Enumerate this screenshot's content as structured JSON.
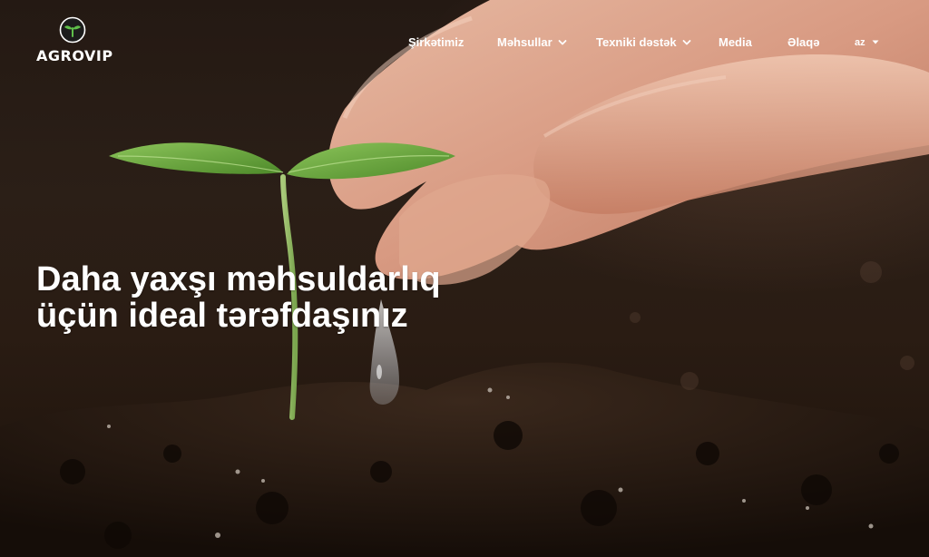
{
  "brand": {
    "logo_text": "AGROVIP"
  },
  "nav": {
    "items": [
      {
        "label": "Şirkətimiz",
        "has_dropdown": false
      },
      {
        "label": "Məhsullar",
        "has_dropdown": true
      },
      {
        "label": "Texniki dəstək",
        "has_dropdown": true
      },
      {
        "label": "Media",
        "has_dropdown": false
      },
      {
        "label": "Əlaqə",
        "has_dropdown": false
      }
    ],
    "language": {
      "label": "az"
    }
  },
  "hero": {
    "headline_line1": "Daha yaxşı məhsuldarlıq",
    "headline_line2": "üçün ideal tərəfdaşınız"
  },
  "colors": {
    "nav_text": "#ffffff",
    "headline_text": "#ffffff",
    "logo_green": "#5fbf4a",
    "leaf_green": "#6fae3c",
    "soil_dark": "#1c120b"
  }
}
